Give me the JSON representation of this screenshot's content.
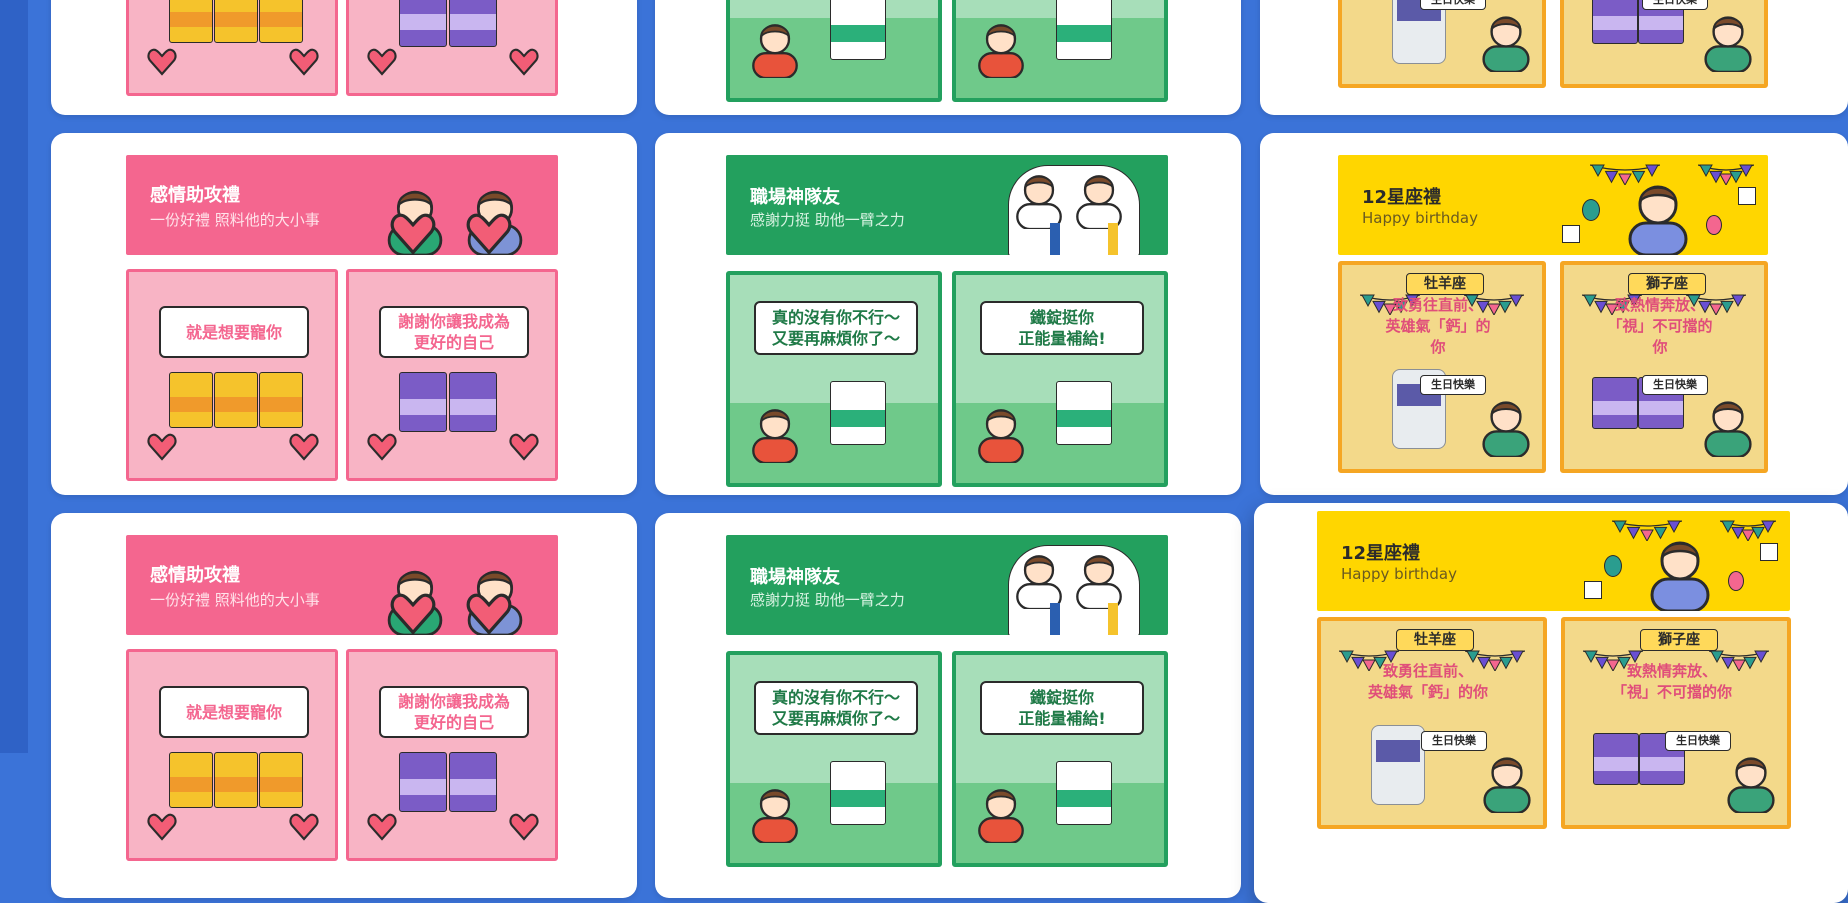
{
  "colors": {
    "page_bg": "#3b73d8",
    "card_bg": "#ffffff",
    "pink": "#f4668f",
    "pink_light": "#f8b4c5",
    "green": "#23a05e",
    "green_light": "#a7deb9",
    "yellow": "#ffd600",
    "yellow_light": "#f3d98a"
  },
  "cards": {
    "pink": {
      "title": "感情助攻禮",
      "subtitle": "一份好禮 照料他的大小事",
      "panel_left_text": "就是想要寵你",
      "panel_right_text": "謝謝你讓我成為\n更好的自己"
    },
    "green": {
      "title": "職場神隊友",
      "subtitle": "感謝力挺 助他一臂之力",
      "panel_left_text": "真的沒有你不行～\n又要再麻煩你了～",
      "panel_right_text": "鐵錠挺你\n正能量補給!"
    },
    "yellow": {
      "title": "12星座禮",
      "subtitle": "Happy birthday",
      "panel_left_label": "牡羊座",
      "panel_left_text": "致勇往直前、\n英雄氣「鈣」的你",
      "panel_right_label": "獅子座",
      "panel_right_text": "致熱情奔放、\n「視」不可擋的你",
      "bottle_tag": "生日快樂"
    }
  }
}
